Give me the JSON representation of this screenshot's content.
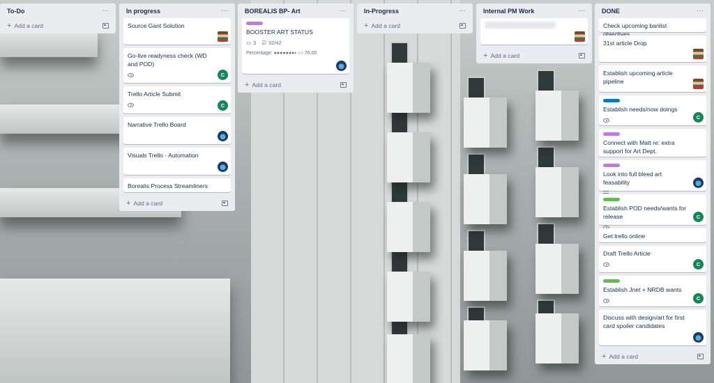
{
  "lists": [
    {
      "title": "To-Do",
      "add_label": "Add a card",
      "cards": []
    },
    {
      "title": "In progress",
      "add_label": "Add a card",
      "cards": [
        {
          "title": "Source Gant Solution",
          "avatar": "pixel-avatar"
        },
        {
          "title": "Go-live readyness check (WD and POD)",
          "badge": "watch",
          "avatar": "C"
        },
        {
          "title": "Trello Article Submit",
          "badge": "watch",
          "avatar": "C"
        },
        {
          "title": "Narrative Trello Board",
          "avatar": "blue-avatar"
        },
        {
          "title": "Visuals Trello - Automation",
          "avatar": "blue-avatar"
        },
        {
          "title": "Borealis Process Streamliners"
        }
      ]
    },
    {
      "title": "BOREALIS BP- Art",
      "add_label": "Add a card",
      "cards": [
        {
          "title": "BOOSTER ART STATUS",
          "label_color": "#c377e0",
          "comments": "3",
          "checklist": "32/42",
          "field": "Percentage: ●●●●●●●◐○○ 76.00",
          "avatar": "blue-avatar"
        }
      ]
    },
    {
      "title": "In-Progress",
      "add_label": "Add a card",
      "cards": []
    },
    {
      "title": "Internal PM Work",
      "add_label": "Add a card",
      "cards": [
        {
          "title": "",
          "blurred": true,
          "avatar": "pixel-avatar"
        }
      ]
    },
    {
      "title": "DONE",
      "add_label": "Add a card",
      "cards": [
        {
          "title": "Check upcoming banlist objectives"
        },
        {
          "title": "31st article Drop",
          "avatar": "pixel-avatar"
        },
        {
          "title": "Establish upcoming article pipeline",
          "avatar": "pixel-avatar"
        },
        {
          "title": "Establish needs/now doings",
          "label_color": "#0079bf",
          "badge": "watch",
          "avatar": "C"
        },
        {
          "title": "Connect with Matt re: extra support for Art Dept.",
          "label_color": "#c377e0"
        },
        {
          "title": "Look into full bleed art feasability",
          "label_color": "#c377e0",
          "badge": "description",
          "avatar": "blue-avatar"
        },
        {
          "title": "Establish POD needs/wants for release",
          "label_color": "#61bd4f",
          "badge": "watch",
          "avatar": "C"
        },
        {
          "title": "Get trello online"
        },
        {
          "title": "Draft Trello Article",
          "badge": "watch",
          "avatar": "C"
        },
        {
          "title": "Establish Jnet + NRDB wants",
          "label_color": "#61bd4f",
          "badge": "watch",
          "avatar": "C"
        },
        {
          "title": "Discuss with design/art for first card spoiler candidates",
          "avatar": "blue-avatar"
        }
      ]
    }
  ],
  "common": {
    "menu_glyph": "···",
    "avatar_letter": "C"
  }
}
